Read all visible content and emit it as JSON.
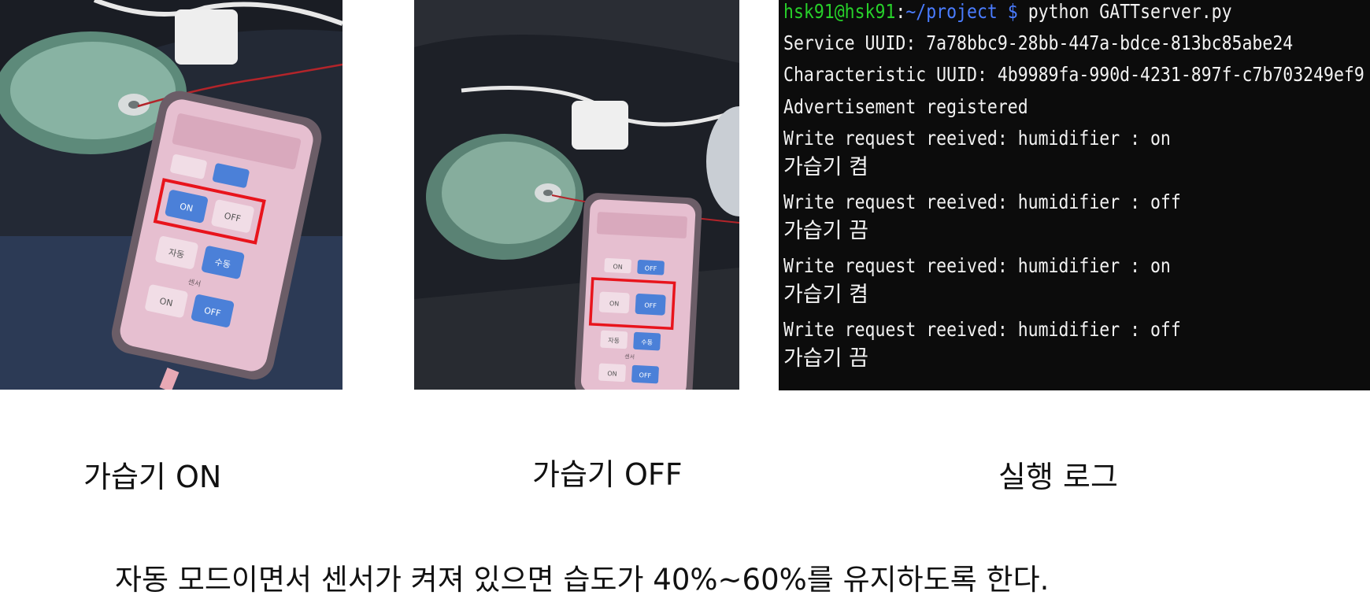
{
  "photos": {
    "on": {
      "phone_ui": {
        "mode_on": "ON",
        "mode_off": "OFF",
        "auto": "자동",
        "manual": "수동",
        "sensor_on": "ON",
        "sensor_off": "OFF",
        "sensor_label": "센서"
      }
    },
    "off": {
      "phone_ui": {
        "mode_on": "ON",
        "mode_off": "OFF",
        "hum_on": "ON",
        "hum_off": "OFF",
        "auto": "자동",
        "manual": "수동",
        "sensor_on": "ON",
        "sensor_off": "OFF",
        "sensor_label": "센서"
      }
    },
    "highlight_color": "#e8141c"
  },
  "terminal": {
    "prompt_user": "hsk91@hsk91",
    "prompt_sep": ":",
    "prompt_path": "~/project $",
    "command": " python GATTserver.py",
    "lines": [
      "Service UUID: 7a78bbc9-28bb-447a-bdce-813bc85abe24",
      "Characteristic UUID: 4b9989fa-990d-4231-897f-c7b703249ef9",
      "Advertisement registered",
      "Write request reeived: humidifier : on",
      "가습기 켬",
      "Write request reeived: humidifier : off",
      "가습기 끔",
      "Write request reeived: humidifier : on",
      "가습기 켬",
      "Write request reeived: humidifier : off",
      "가습기 끔"
    ],
    "colors": {
      "background": "#0c0c0c",
      "user": "#27d02a",
      "path": "#4a7cff",
      "text": "#f2f2f2"
    }
  },
  "captions": {
    "on": "가습기 ON",
    "off": "가습기 OFF",
    "log": "실행 로그"
  },
  "footer": "자동 모드이면서 센서가 켜져 있으면 습도가 40%~60%를 유지하도록 한다."
}
